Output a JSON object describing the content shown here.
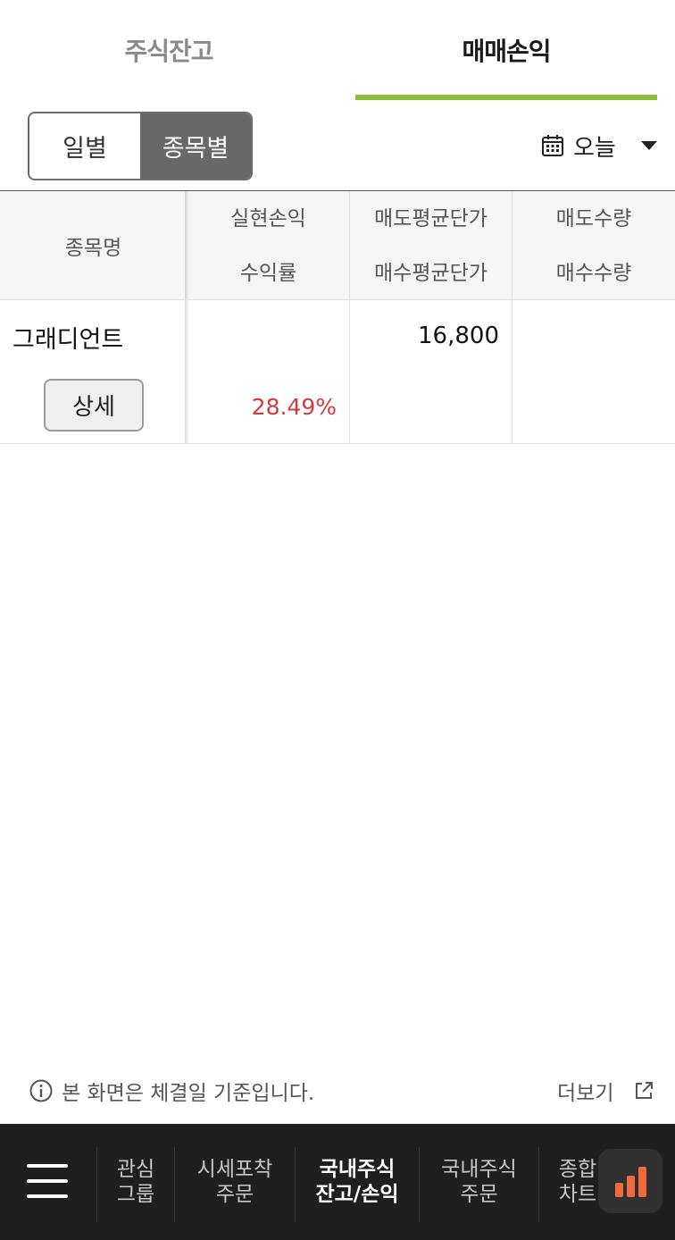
{
  "top_tabs": [
    {
      "label": "주식잔고",
      "active": false
    },
    {
      "label": "매매손익",
      "active": true
    }
  ],
  "colors": {
    "accent": "#8bbd3b",
    "profit": "#d23b3b",
    "nav_bg": "#1f1f1f",
    "fab_bar": "#f06a3c"
  },
  "segment": {
    "daily": "일별",
    "by_stock": "종목별",
    "selected": "종목별"
  },
  "date_selector": {
    "value": "오늘",
    "icon": "calendar-icon"
  },
  "table": {
    "header_name": "종목명",
    "columns": [
      {
        "top": "실현손익",
        "bottom": "수익률"
      },
      {
        "top": "매도평균단가",
        "bottom": "매수평균단가"
      },
      {
        "top": "매도수량",
        "bottom": "매수수량"
      }
    ],
    "rows": [
      {
        "name": "그래디언트",
        "detail_label": "상세",
        "realized_pl": "",
        "return_rate": "28.49%",
        "sell_avg_price": "16,800",
        "buy_avg_price": "",
        "sell_qty": "",
        "buy_qty": ""
      }
    ]
  },
  "notice": {
    "text": "본 화면은 체결일 기준입니다.",
    "more_label": "더보기"
  },
  "bottom_nav": {
    "items": [
      {
        "line1": "관심",
        "line2": "그룹",
        "active": false
      },
      {
        "line1": "시세포착",
        "line2": "주문",
        "active": false
      },
      {
        "line1": "국내주식",
        "line2": "잔고/손익",
        "active": true
      },
      {
        "line1": "국내주식",
        "line2": "주문",
        "active": false
      },
      {
        "line1": "종합",
        "line2": "차트",
        "active": false
      }
    ]
  }
}
